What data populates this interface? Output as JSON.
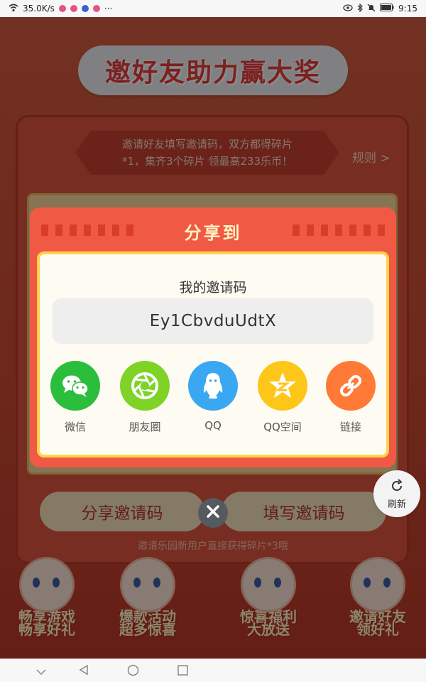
{
  "status_bar": {
    "network_speed": "35.0K/s",
    "time": "9:15",
    "more": "···"
  },
  "page": {
    "title": "邀好友助力赢大奖",
    "notice_line1": "邀请好友填写邀请码，双方都得碎片",
    "notice_line2": "*1，集齐3个碎片 领最高233乐币！",
    "rules_link": "规则 >",
    "share_code_button": "分享邀请码",
    "enter_code_button": "填写邀请码",
    "hint": "邀请乐园新用户直接获得碎片*3哦",
    "refresh_label": "刷新",
    "features": [
      {
        "line1": "畅享游戏",
        "line2": "畅享好礼"
      },
      {
        "line1": "爆款活动",
        "line2": "超多惊喜"
      },
      {
        "line1": "惊喜福利",
        "line2": "大放送"
      },
      {
        "line1": "邀请好友",
        "line2": "领好礼"
      }
    ]
  },
  "modal": {
    "title": "分享到",
    "code_label": "我的邀请码",
    "invite_code": "Ey1CbvduUdtX",
    "share_targets": [
      {
        "label": "微信",
        "icon": "wechat-icon",
        "color": "#2bbd3c"
      },
      {
        "label": "朋友圈",
        "icon": "moments-icon",
        "color": "#7fd327"
      },
      {
        "label": "QQ",
        "icon": "qq-icon",
        "color": "#3aa7f2"
      },
      {
        "label": "QQ空间",
        "icon": "qzone-icon",
        "color": "#ffc61a"
      },
      {
        "label": "链接",
        "icon": "link-icon",
        "color": "#ff7a36"
      }
    ]
  },
  "colors": {
    "modal_bg": "#f05a44",
    "modal_border": "#ffd34d",
    "page_bg": "#cf5a3f"
  }
}
